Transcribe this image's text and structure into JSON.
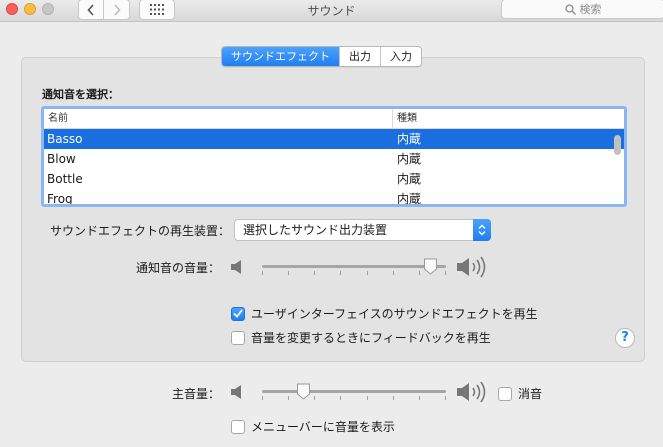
{
  "window": {
    "title": "サウンド"
  },
  "toolbar": {
    "search_placeholder": "検索"
  },
  "tabs": [
    {
      "label": "サウンドエフェクト",
      "active": true
    },
    {
      "label": "出力",
      "active": false
    },
    {
      "label": "入力",
      "active": false
    }
  ],
  "alert_section": {
    "label": "通知音を選択：",
    "columns": {
      "name": "名前",
      "type": "種類"
    },
    "rows": [
      {
        "name": "Basso",
        "type": "内蔵",
        "selected": true
      },
      {
        "name": "Blow",
        "type": "内蔵",
        "selected": false
      },
      {
        "name": "Bottle",
        "type": "内蔵",
        "selected": false
      },
      {
        "name": "Frog",
        "type": "内蔵",
        "selected": false
      }
    ]
  },
  "output_device": {
    "label": "サウンドエフェクトの再生装置：",
    "value": "選択したサウンド出力装置"
  },
  "alert_volume": {
    "label": "通知音の音量：",
    "level": 1.0
  },
  "checkboxes": {
    "ui_effects": {
      "label": "ユーザインターフェイスのサウンドエフェクトを再生",
      "checked": true
    },
    "feedback": {
      "label": "音量を変更するときにフィードバックを再生",
      "checked": false
    }
  },
  "help": {
    "label": "?"
  },
  "main_volume": {
    "label": "主音量：",
    "level": 0.2,
    "mute_label": "消音",
    "muted": false
  },
  "menubar": {
    "label": "メニューバーに音量を表示",
    "checked": false
  },
  "colors": {
    "accent": "#1f7ff1",
    "selection": "#1a6fe0"
  }
}
